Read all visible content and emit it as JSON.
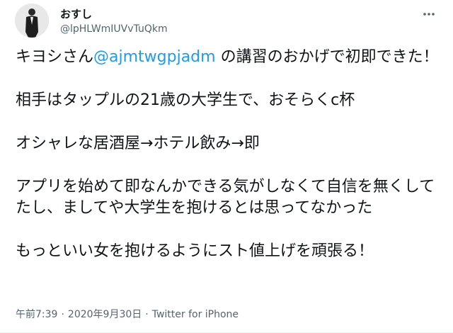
{
  "author": {
    "display_name": "おすし",
    "handle": "@lpHLWmIUVvTuQkm"
  },
  "tweet": {
    "line1_before": "キヨシさん",
    "mention": "@ajmtwgpjadm",
    "line1_after": " の講習のおかげで初即できた！",
    "para2": "相手はタップルの21歳の大学生で、おそらくc杯",
    "para3": "オシャレな居酒屋→ホテル飲み→即",
    "para4": "アプリを始めて即なんかできる気がしなくて自信を無くしてたし、ましてや大学生を抱けるとは思ってなかった",
    "para5": "もっといい女を抱けるようにスト値上げを頑張る！"
  },
  "meta": {
    "time": "午前7:39",
    "separator": "·",
    "date": "2020年9月30日",
    "source": "Twitter for iPhone"
  },
  "icons": {
    "more": "more-horizontal-icon",
    "avatar": "avatar-photo"
  },
  "colors": {
    "mention": "#1d9bf0",
    "secondary_text": "#536471",
    "primary_text": "#0f1419"
  }
}
